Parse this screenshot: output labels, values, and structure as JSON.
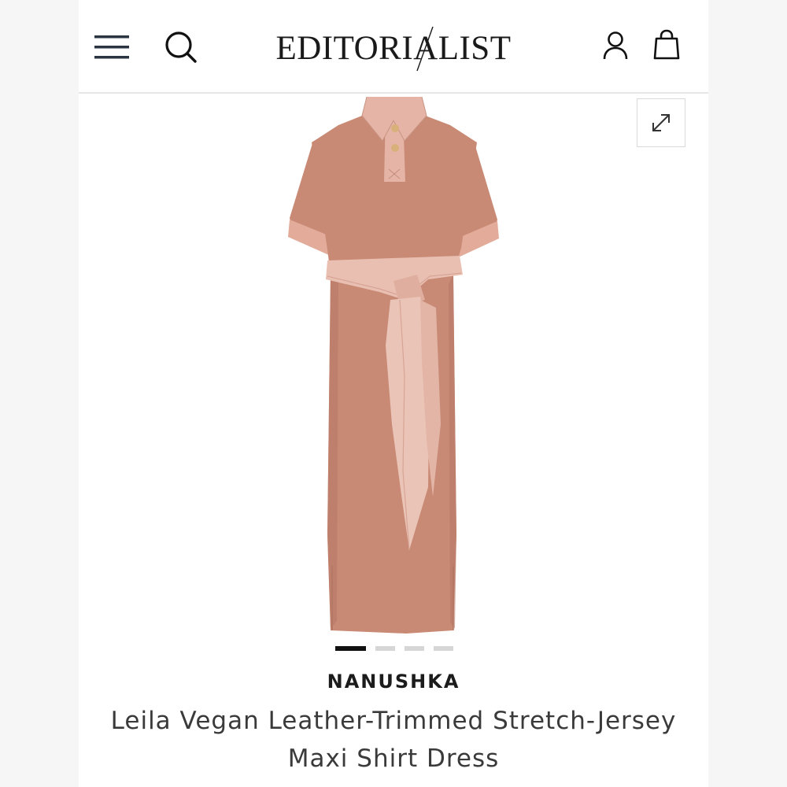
{
  "header": {
    "logo_text": "EDITORIALIST",
    "menu_icon": "hamburger-menu-icon",
    "search_icon": "search-icon",
    "account_icon": "user-icon",
    "bag_icon": "shopping-bag-icon"
  },
  "gallery": {
    "expand_icon": "expand-arrows-icon",
    "slide_count": 4,
    "active_slide": 1,
    "colors": {
      "dress": "#c98a75",
      "trim": "#e6b4a6",
      "button": "#d8b07a"
    }
  },
  "product": {
    "brand": "NANUSHKA",
    "title_line1": "Leila Vegan Leather-Trimmed Stretch-Jersey",
    "title_line2": "Maxi Shirt Dress"
  }
}
